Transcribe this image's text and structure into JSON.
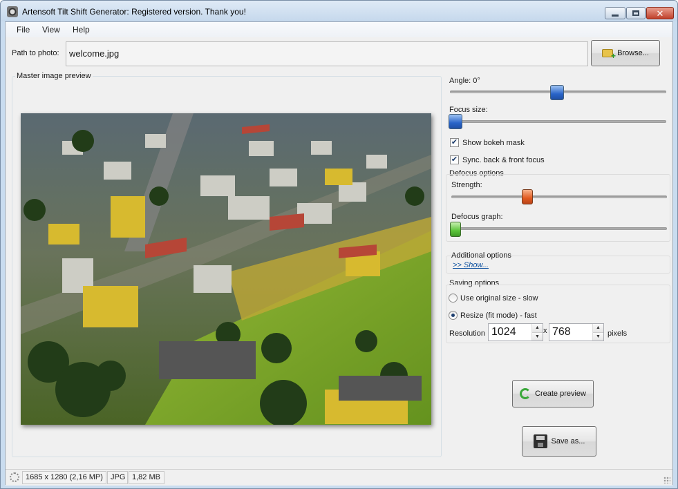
{
  "window": {
    "title": "Artensoft Tilt Shift Generator: Registered version. Thank you!"
  },
  "menu": {
    "items": [
      "File",
      "View",
      "Help"
    ]
  },
  "path": {
    "label": "Path to photo:",
    "value": "welcome.jpg",
    "browse_label": "Browse..."
  },
  "preview": {
    "label": "Master image preview"
  },
  "controls": {
    "angle_label": "Angle: 0°",
    "focus_size_label": "Focus size:",
    "show_bokeh_mask": {
      "label": "Show bokeh mask",
      "checked": true
    },
    "sync_focus": {
      "label": "Sync. back & front focus",
      "checked": true
    }
  },
  "defocus": {
    "title": "Defocus options",
    "strength_label": "Strength:",
    "graph_label": "Defocus graph:"
  },
  "additional": {
    "title": "Additional options",
    "link": ">> Show..."
  },
  "saving": {
    "title": "Saving options",
    "original": {
      "label": "Use original size - slow",
      "selected": false
    },
    "resize": {
      "label": "Resize (fit mode) - fast",
      "selected": true
    },
    "resolution_label": "Resolution",
    "width": "1024",
    "separator": "x",
    "height": "768",
    "units": "pixels"
  },
  "buttons": {
    "create_preview": "Create preview",
    "save_as": "Save as..."
  },
  "status": {
    "dimensions": "1685 x 1280 (2,16 MP)",
    "format": "JPG",
    "size": "1,82 MB"
  }
}
